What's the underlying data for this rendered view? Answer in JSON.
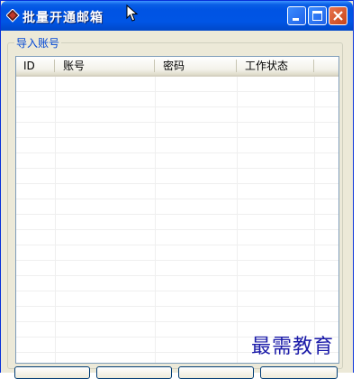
{
  "window": {
    "title": "批量开通邮箱",
    "controls": {
      "minimize": "minimize",
      "maximize": "maximize",
      "close": "close"
    }
  },
  "group": {
    "label": "导入账号"
  },
  "table": {
    "columns": [
      "ID",
      "账号",
      "密码",
      "工作状态"
    ],
    "rows": []
  },
  "watermark": "最需教育",
  "colors": {
    "title_bar": "#0055e5",
    "accent": "#0046d5",
    "close": "#c64419"
  },
  "icons": [
    "app-icon",
    "cursor-icon",
    "minimize-icon",
    "maximize-icon",
    "close-icon"
  ]
}
